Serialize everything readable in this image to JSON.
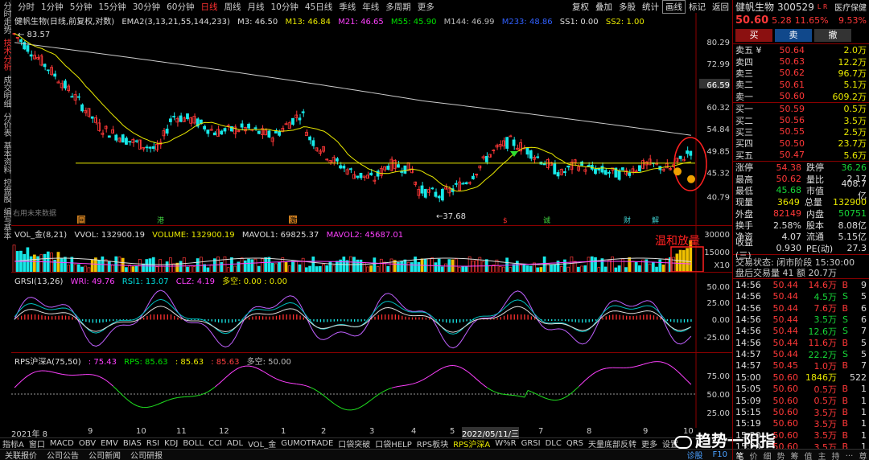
{
  "left_tabs": [
    "分时走势",
    "技术分析",
    "成交明细",
    "分价表",
    "基本资料",
    "控盘股",
    "编写基本"
  ],
  "toolbar": {
    "periods": [
      "分时",
      "1分钟",
      "5分钟",
      "15分钟",
      "30分钟",
      "60分钟",
      "日线",
      "周线",
      "月线",
      "10分钟",
      "45日线",
      "季线",
      "年线",
      "多周期",
      "更多"
    ],
    "active_period": "日线",
    "right": [
      "复权",
      "叠加",
      "多股",
      "统计",
      "画线",
      "标记",
      "返回"
    ]
  },
  "main_chart": {
    "legend_name": "健帆生物(日线,前复权,对数)",
    "ema": "EMA2(3,13,21,55,144,233)",
    "m3": "M3: 46.50",
    "m13": "M13: 46.84",
    "m21": "M21: 46.65",
    "m55": "M55: 45.90",
    "m144": "M144: 46.99",
    "m233": "M233: 48.86",
    "ss1": "SS1: 0.00",
    "ss2": "SS2: 1.00",
    "yticks": [
      "80.29",
      "72.99",
      "66.59",
      "60.32",
      "54.84",
      "49.85",
      "45.32",
      "40.79"
    ],
    "high_label": "83.57",
    "low_label": "37.68",
    "future_label": "右用未来数据",
    "markers": [
      "回",
      "港",
      "激",
      "$",
      "诚",
      "财",
      "解"
    ]
  },
  "vol_panel": {
    "legend_name": "VOL_金(8,21)",
    "vvol": "VVOL: 132900.19",
    "volume": "VOLUME: 132900.19",
    "mavol1": "MAVOL1: 69825.37",
    "mavol2": "MAVOL2: 45687.01",
    "yticks": [
      "30000",
      "15000",
      "X10"
    ],
    "annotation": "温和放量"
  },
  "grsi_panel": {
    "legend_name": "GRSI(13,26)",
    "wri": "WRI: 49.76",
    "rsi1": "RSI1: 13.07",
    "clz": "CLZ: 4.19",
    "ks": "多空: 0.00 : 0.00",
    "yticks": [
      "50.00",
      "25.00",
      "0.00",
      "-25.00"
    ]
  },
  "rps_panel": {
    "legend_name": "RPS沪深A(75,50)",
    "a": ": 75.43",
    "rps": "RPS: 85.63",
    "b": ": 85.63",
    "c": ": 85.63",
    "ks": "多空: 50.00",
    "yticks": [
      "75.00",
      "50.00",
      "25.00"
    ]
  },
  "xaxis": {
    "labels": [
      "2021年 8",
      "9",
      "10",
      "11",
      "12",
      "1",
      "2",
      "3",
      "4",
      "5",
      "2022/05/11/三",
      "7",
      "8",
      "9",
      "10"
    ]
  },
  "indicator_tabs": [
    "指标A",
    "窗口",
    "MACD",
    "OBV",
    "EMV",
    "BIAS",
    "RSI",
    "KDJ",
    "BOLL",
    "CCI",
    "ADL",
    "VOL_金",
    "GUMOTRADE",
    "口袋突破",
    "口袋HELP",
    "RPS板块",
    "RPS沪深A",
    "W%R",
    "GRSI",
    "DLC",
    "QRS",
    "天量底部反转",
    "更多",
    "设置"
  ],
  "indicator_active": "RPS沪深A",
  "status_items": [
    "关联报价",
    "公司公告",
    "公司新闻",
    "公司研报"
  ],
  "status_right": [
    "诊股",
    "F10"
  ],
  "watermark": "趋势一阳指",
  "stock": {
    "name": "健帆生物",
    "code": "300529",
    "tags": "L R",
    "industry": "医疗保健",
    "price": "50.60",
    "change": "5.28",
    "pct": "11.65%",
    "pct_right": "9.53%",
    "buttons": [
      "买",
      "卖",
      "撤",
      "买"
    ],
    "sells": [
      [
        "卖五 ¥",
        "50.64",
        "2.0万"
      ],
      [
        "卖四",
        "50.63",
        "12.2万"
      ],
      [
        "卖三",
        "50.62",
        "96.7万"
      ],
      [
        "卖二",
        "50.61",
        "5.1万"
      ],
      [
        "卖一",
        "50.60",
        "609.2万"
      ]
    ],
    "buys": [
      [
        "买一",
        "50.59",
        "0.5万"
      ],
      [
        "买二",
        "50.56",
        "3.5万"
      ],
      [
        "买三",
        "50.55",
        "2.5万"
      ],
      [
        "买四",
        "50.50",
        "23.7万"
      ],
      [
        "买五",
        "50.47",
        "5.6万"
      ]
    ],
    "stats": [
      [
        "涨停",
        "54.38",
        "跌停",
        "36.26"
      ],
      [
        "最高",
        "50.62",
        "量比",
        "2.17"
      ],
      [
        "最低",
        "45.68",
        "市值",
        "408.7亿"
      ],
      [
        "现量",
        "3649",
        "总量",
        "132900"
      ],
      [
        "外盘",
        "82149",
        "内盘",
        "50751"
      ],
      [
        "换手",
        "2.58%",
        "股本",
        "8.08亿"
      ],
      [
        "净资",
        "4.07",
        "流通",
        "5.15亿"
      ],
      [
        "收益(三)",
        "0.930",
        "PE(动)",
        "27.3"
      ]
    ],
    "trade_status": "交易状态: 闭市阶段 15:30:00",
    "after_hours": "盘后交易量 41 额 20.7万",
    "ticks": [
      [
        "14:56",
        "50.44",
        "14.6万",
        "B",
        "9"
      ],
      [
        "14:56",
        "50.44",
        "4.5万",
        "S",
        "5"
      ],
      [
        "14:56",
        "50.44",
        "7.6万",
        "B",
        "6"
      ],
      [
        "14:56",
        "50.44",
        "3.5万",
        "S",
        "6"
      ],
      [
        "14:56",
        "50.44",
        "12.6万",
        "S",
        "7"
      ],
      [
        "14:56",
        "50.44",
        "11.6万",
        "B",
        "5"
      ],
      [
        "14:57",
        "50.44",
        "22.2万",
        "S",
        "5"
      ],
      [
        "14:57",
        "50.45",
        "1.0万",
        "B",
        "7"
      ],
      [
        "15:00",
        "50.60",
        "1846万",
        "",
        "522"
      ],
      [
        "15:05",
        "50.60",
        "0.5万",
        "B",
        "1"
      ],
      [
        "15:09",
        "50.60",
        "0.5万",
        "B",
        "1"
      ],
      [
        "15:15",
        "50.60",
        "3.5万",
        "B",
        "1"
      ],
      [
        "15:19",
        "50.60",
        "3.5万",
        "B",
        "1"
      ],
      [
        "15:20",
        "50.60",
        "3.5万",
        "B",
        "1"
      ],
      [
        "15:20",
        "50.60",
        "3.5万",
        "B",
        "1"
      ],
      [
        "15:30",
        "50.60",
        "3.5万",
        "B",
        "1"
      ]
    ],
    "bottom_tabs": [
      "笔",
      "价",
      "细",
      "势",
      "筹",
      "值",
      "主",
      "持",
      "...",
      "尊"
    ]
  }
}
